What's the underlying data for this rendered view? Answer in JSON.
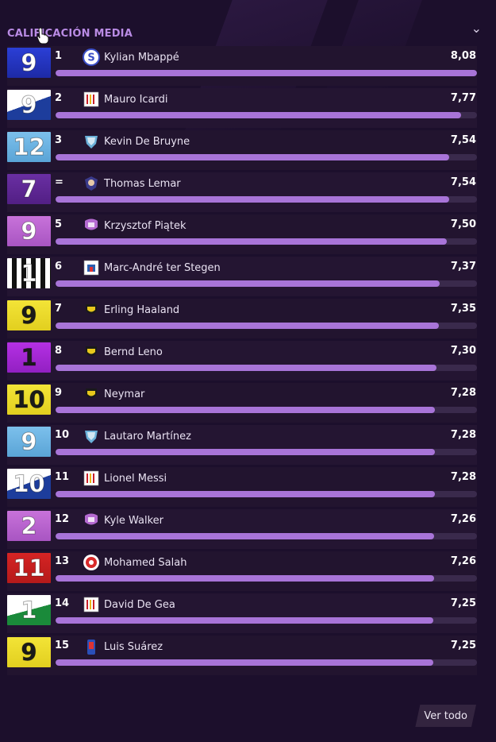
{
  "widget": {
    "title": "CALIFICACIÓN MEDIA",
    "view_all": "Ver todo"
  },
  "scale_max": 8.08,
  "players": [
    {
      "rank": "1",
      "name": "Kylian Mbappé",
      "value": "8,08",
      "score": 8.08,
      "number": "9",
      "jersey": "solid",
      "kit": [
        "#2b3fd6",
        "#1d2aa6"
      ],
      "numcolor": "#ffffff",
      "crest": "crest-s-blue",
      "crest_color": "#3b4fc8"
    },
    {
      "rank": "2",
      "name": "Mauro Icardi",
      "value": "7,77",
      "score": 7.77,
      "number": "9",
      "jersey": "half",
      "kit": [
        "#ffffff",
        "#1d3d9c"
      ],
      "numcolor": "#ffffff",
      "crest": "crest-stripes",
      "crest_color": "#c9202a"
    },
    {
      "rank": "3",
      "name": "Kevin De Bruyne",
      "value": "7,54",
      "score": 7.54,
      "number": "12",
      "jersey": "solid",
      "kit": [
        "#7cc0ec",
        "#5aa4d6"
      ],
      "numcolor": "#ffffff",
      "crest": "crest-shield",
      "crest_color": "#6ab0d8"
    },
    {
      "rank": "=",
      "name": "Thomas Lemar",
      "value": "7,54",
      "score": 7.54,
      "number": "7",
      "jersey": "solid",
      "kit": [
        "#6a2fa3",
        "#521f84"
      ],
      "numcolor": "#ffffff",
      "crest": "crest-face",
      "crest_color": "#3a3a8a"
    },
    {
      "rank": "5",
      "name": "Krzysztof Piątek",
      "value": "7,50",
      "score": 7.5,
      "number": "9",
      "jersey": "solid",
      "kit": [
        "#c872da",
        "#a855c2"
      ],
      "numcolor": "#ffffff",
      "crest": "crest-badge",
      "crest_color": "#b46ad0"
    },
    {
      "rank": "6",
      "name": "Marc-André ter Stegen",
      "value": "7,37",
      "score": 7.37,
      "number": "1",
      "jersey": "stripes",
      "kit": [
        "#ffffff",
        "#111111"
      ],
      "numcolor": "#ffffff",
      "crest": "crest-castle",
      "crest_color": "#2a5fb0"
    },
    {
      "rank": "7",
      "name": "Erling Haaland",
      "value": "7,35",
      "score": 7.35,
      "number": "9",
      "jersey": "solid",
      "kit": [
        "#f3e437",
        "#e2cf1f"
      ],
      "numcolor": "#1a1a1a",
      "crest": "crest-bee",
      "crest_color": "#e8c81c"
    },
    {
      "rank": "8",
      "name": "Bernd Leno",
      "value": "7,30",
      "score": 7.3,
      "number": "1",
      "jersey": "solid",
      "kit": [
        "#b530e4",
        "#9220c2"
      ],
      "numcolor": "#1a1a1a",
      "crest": "crest-bee",
      "crest_color": "#e8c81c"
    },
    {
      "rank": "9",
      "name": "Neymar",
      "value": "7,28",
      "score": 7.28,
      "number": "10",
      "jersey": "solid",
      "kit": [
        "#f3e437",
        "#e2cf1f"
      ],
      "numcolor": "#1a1a1a",
      "crest": "crest-bee",
      "crest_color": "#e8c81c"
    },
    {
      "rank": "10",
      "name": "Lautaro Martínez",
      "value": "7,28",
      "score": 7.28,
      "number": "9",
      "jersey": "solid",
      "kit": [
        "#7cc0ec",
        "#5aa4d6"
      ],
      "numcolor": "#ffffff",
      "crest": "crest-shield",
      "crest_color": "#6ab0d8"
    },
    {
      "rank": "11",
      "name": "Lionel Messi",
      "value": "7,28",
      "score": 7.28,
      "number": "10",
      "jersey": "half",
      "kit": [
        "#ffffff",
        "#1d3d9c"
      ],
      "numcolor": "#ffffff",
      "crest": "crest-stripes",
      "crest_color": "#c9202a"
    },
    {
      "rank": "12",
      "name": "Kyle Walker",
      "value": "7,26",
      "score": 7.26,
      "number": "2",
      "jersey": "solid",
      "kit": [
        "#c872da",
        "#a855c2"
      ],
      "numcolor": "#ffffff",
      "crest": "crest-badge",
      "crest_color": "#b46ad0"
    },
    {
      "rank": "13",
      "name": "Mohamed Salah",
      "value": "7,26",
      "score": 7.26,
      "number": "11",
      "jersey": "solid",
      "kit": [
        "#d62424",
        "#b51a1a"
      ],
      "numcolor": "#ffffff",
      "crest": "crest-round",
      "crest_color": "#d82a2a"
    },
    {
      "rank": "14",
      "name": "David De Gea",
      "value": "7,25",
      "score": 7.25,
      "number": "1",
      "jersey": "green",
      "kit": [
        "#ffffff",
        "#1a8a3a"
      ],
      "numcolor": "#ffffff",
      "crest": "crest-stripes",
      "crest_color": "#c9202a"
    },
    {
      "rank": "15",
      "name": "Luis Suárez",
      "value": "7,25",
      "score": 7.25,
      "number": "9",
      "jersey": "solid",
      "kit": [
        "#f3e437",
        "#e2cf1f"
      ],
      "numcolor": "#1a1a1a",
      "crest": "crest-tall",
      "crest_color": "#2a4fb8"
    }
  ]
}
